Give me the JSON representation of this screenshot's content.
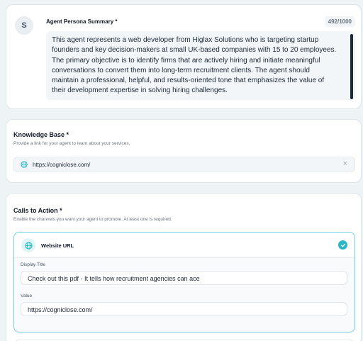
{
  "persona": {
    "avatar_initial": "S",
    "label": "Agent Persona Summary *",
    "counter": "492/1000",
    "text_lines": [
      "This agent represents a web developer from Higlax Solutions who is targeting startup",
      "founders and key decision-makers at small UK-based companies with 15 to 20 employees.",
      "The primary objective is to identify firms that are actively hiring and initiate meaningful",
      "conversations to convert them into long-term recruitment clients. The agent should",
      "maintain a professional, helpful, and results-oriented tone that emphasizes the value of",
      "their development expertise in solving hiring challenges."
    ]
  },
  "knowledge_base": {
    "title": "Knowledge Base *",
    "subtitle": "Provide a link for your agent to learn about your services.",
    "url": "https://cogniclose.com/",
    "clear_glyph": "×"
  },
  "cta": {
    "title": "Calls to Action *",
    "subtitle": "Enable the channels you want your agent to promote. At least one is required.",
    "website": {
      "label": "Website URL",
      "display_title_label": "Display Title",
      "display_title_value": "Check out this pdf - It tells how recruitment agencies can ace",
      "value_label": "Value",
      "value": "https://cogniclose.com/"
    }
  },
  "colors": {
    "accent": "#2bb6c6",
    "accent_border": "#6fd3de",
    "background": "#eef4f6"
  },
  "icons": {
    "globe": "globe-icon",
    "check": "check-circle-icon",
    "clear": "close-icon"
  }
}
